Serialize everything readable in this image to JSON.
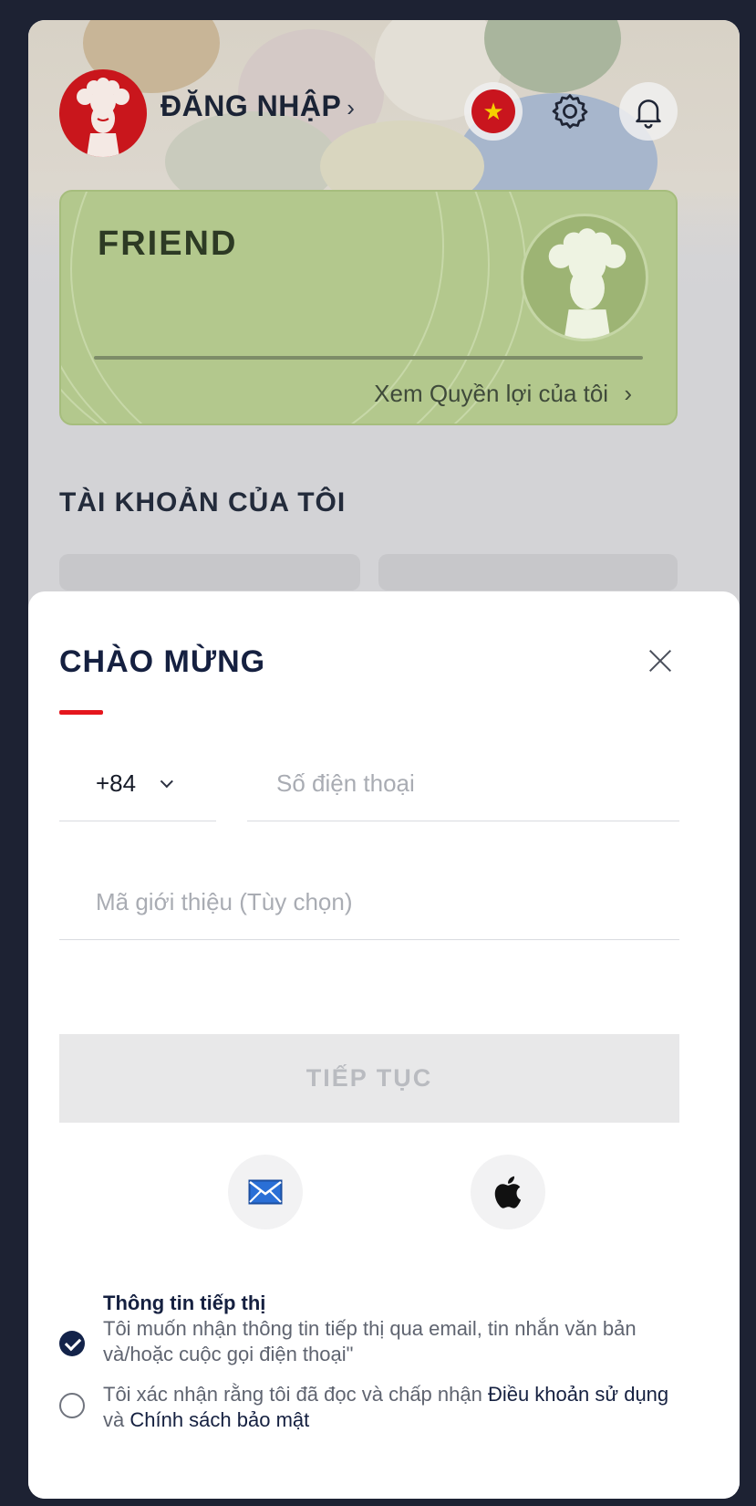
{
  "header": {
    "login_label": "ĐĂNG NHẬP",
    "login_chevron": "›"
  },
  "membership": {
    "tier": "FRIEND",
    "benefits_link": "Xem Quyền lợi của tôi",
    "benefits_chevron": "›"
  },
  "account_section": {
    "title": "TÀI KHOẢN CỦA TÔI"
  },
  "modal": {
    "title": "CHÀO MỪNG",
    "country_code": "+84",
    "phone_placeholder": "Số điện thoại",
    "referral_placeholder": "Mã giới thiệu (Tùy chọn)",
    "continue_label": "TIẾP TỤC",
    "marketing": {
      "title": "Thông tin tiếp thị",
      "text": "Tôi muốn nhận thông tin tiếp thị qua email, tin nhắn văn bản và/hoặc cuộc gọi điện thoại\"",
      "checked": true
    },
    "terms": {
      "text_before": "Tôi xác nhận rằng tôi đã đọc và chấp nhận ",
      "terms_link": "Điều khoản sử dụng",
      "joiner": " và ",
      "privacy_link": "Chính sách bảo mật",
      "checked": false
    }
  },
  "icons": [
    "vietnam-flag-icon",
    "gear-icon",
    "bell-icon",
    "close-icon",
    "chevron-down-icon",
    "mail-icon",
    "apple-icon",
    "check-icon"
  ],
  "colors": {
    "accent_red": "#e5161d",
    "navy": "#152040",
    "member_green": "#b3c88d"
  }
}
